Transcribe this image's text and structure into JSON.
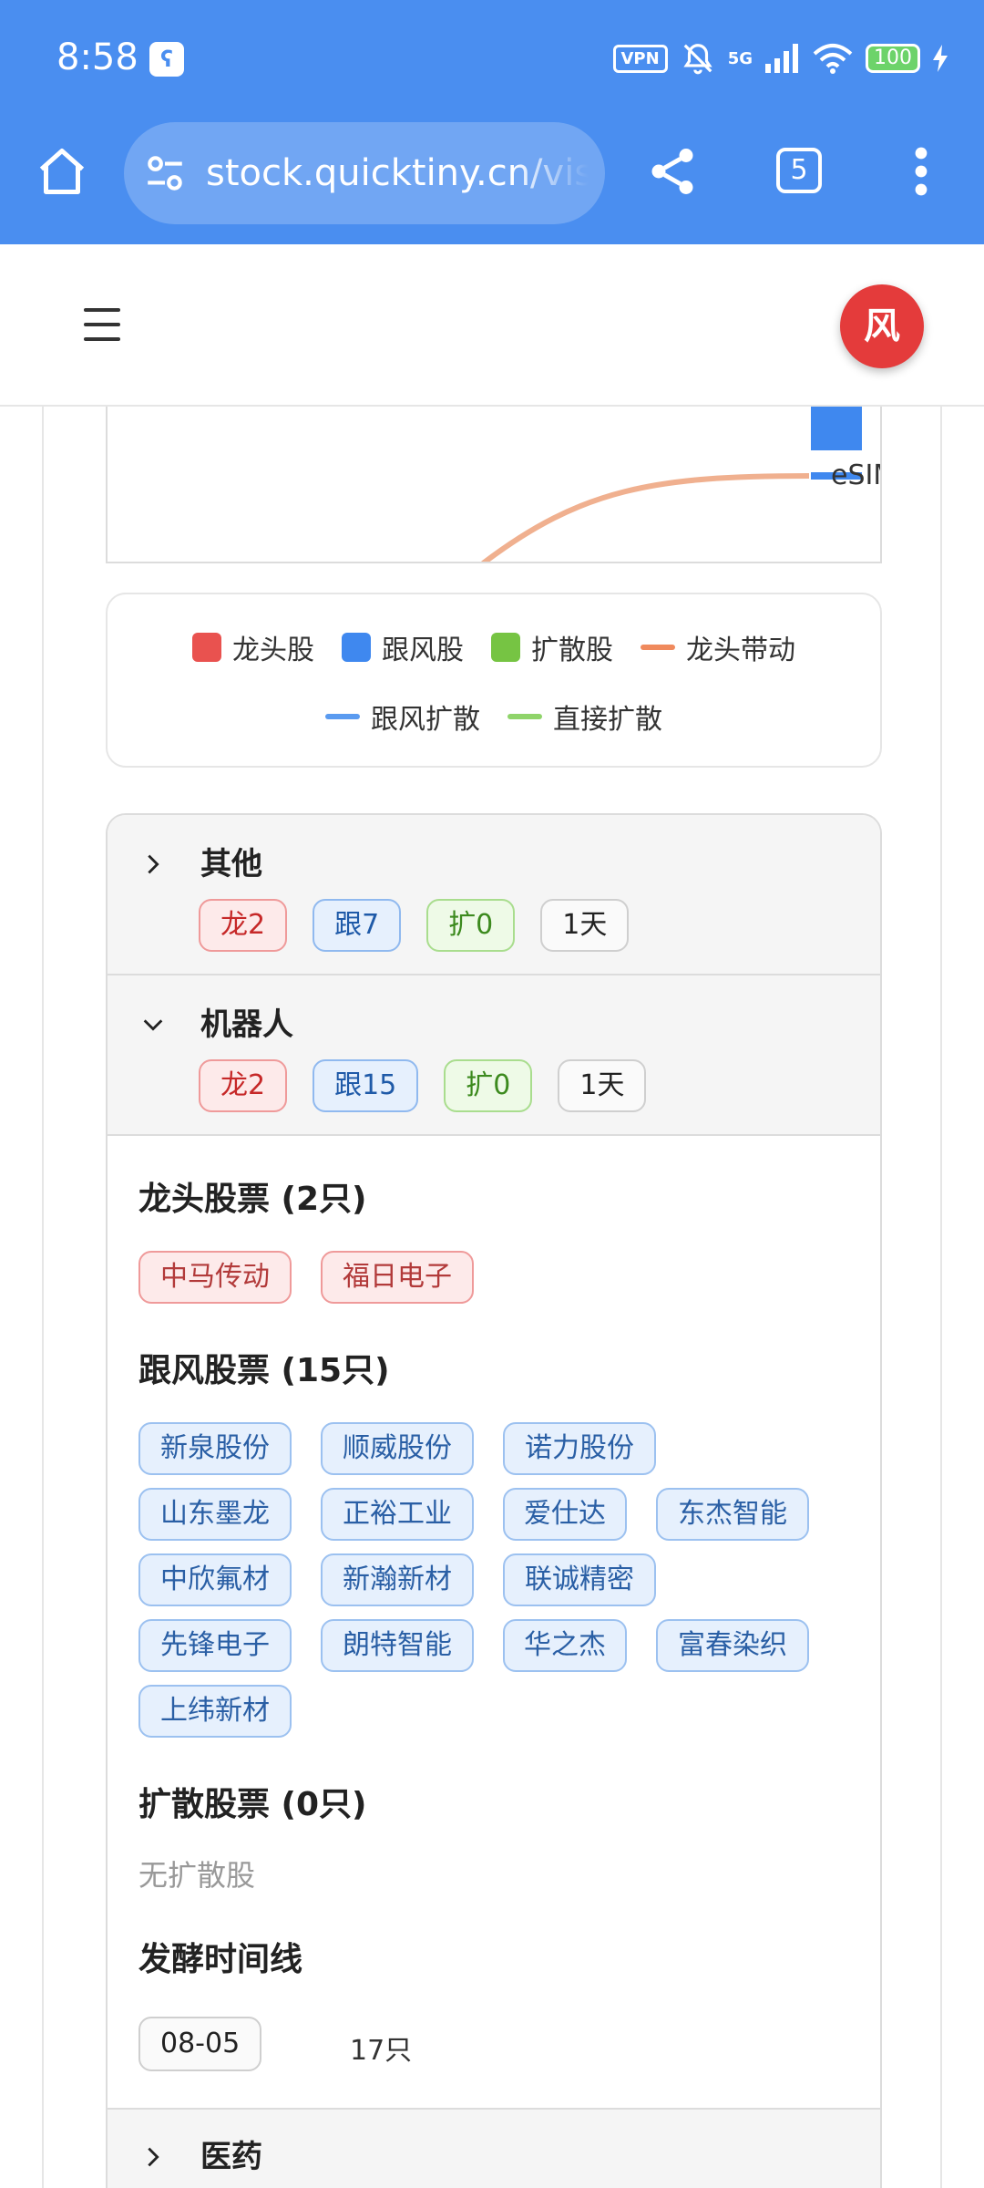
{
  "status_bar": {
    "time": "8:58",
    "notif": "ʕ",
    "vpn": "VPN",
    "network": "5G",
    "battery": "100"
  },
  "browser": {
    "url": "stock.quicktiny.cn/vis",
    "tab_count": "5"
  },
  "app": {
    "avatar_label": "风"
  },
  "graph": {
    "node_label": "eSIM",
    "colors": {
      "leader": "#e9524f",
      "follower": "#3f88ef",
      "spread": "#76c443",
      "leader_link": "#f0b08f",
      "follower_link": "#5a9bf0",
      "direct_link": "#8fd46a"
    }
  },
  "legend": {
    "row1": [
      {
        "label": "龙头股",
        "type": "box",
        "color": "#e9524f"
      },
      {
        "label": "跟风股",
        "type": "box",
        "color": "#3f88ef"
      },
      {
        "label": "扩散股",
        "type": "box",
        "color": "#76c443"
      },
      {
        "label": "龙头带动",
        "type": "line",
        "color": "#f08a5d"
      }
    ],
    "row2": [
      {
        "label": "跟风扩散",
        "type": "line",
        "color": "#5a9bf0"
      },
      {
        "label": "直接扩散",
        "type": "line",
        "color": "#8fd46a"
      }
    ]
  },
  "sectors": [
    {
      "name": "其他",
      "expanded": false,
      "pills": {
        "leader": "龙2",
        "follower": "跟7",
        "spread": "扩0",
        "days": "1天"
      }
    },
    {
      "name": "机器人",
      "expanded": true,
      "pills": {
        "leader": "龙2",
        "follower": "跟15",
        "spread": "扩0",
        "days": "1天"
      },
      "leader_title": "龙头股票 (2只)",
      "leaders": [
        "中马传动",
        "福日电子"
      ],
      "follower_title": "跟风股票 (15只)",
      "followers": [
        "新泉股份",
        "顺威股份",
        "诺力股份",
        "山东墨龙",
        "正裕工业",
        "爱仕达",
        "东杰智能",
        "中欣氟材",
        "新瀚新材",
        "联诚精密",
        "先锋电子",
        "朗特智能",
        "华之杰",
        "富春染织",
        "上纬新材"
      ],
      "spread_title": "扩散股票 (0只)",
      "spread_empty": "无扩散股",
      "timeline_title": "发酵时间线",
      "timeline": [
        {
          "date": "08-05",
          "count": "17只"
        }
      ]
    },
    {
      "name": "医药",
      "expanded": false
    }
  ]
}
